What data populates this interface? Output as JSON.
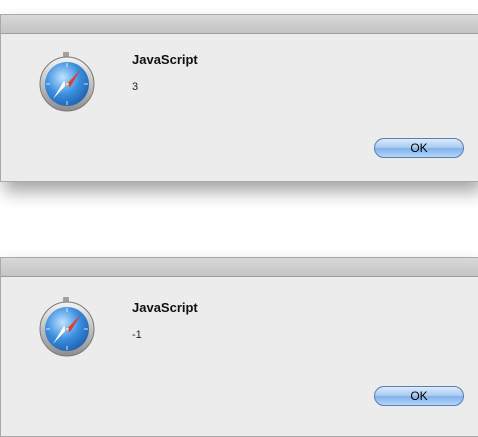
{
  "dialogs": [
    {
      "title": "JavaScript",
      "message": "3",
      "button_label": "OK",
      "icon": "safari-compass-icon"
    },
    {
      "title": "JavaScript",
      "message": "-1",
      "button_label": "OK",
      "icon": "safari-compass-icon"
    }
  ],
  "colors": {
    "dialog_bg": "#ececec",
    "button_accent": "#7fb1ea",
    "compass_blue": "#3a8fe0"
  }
}
